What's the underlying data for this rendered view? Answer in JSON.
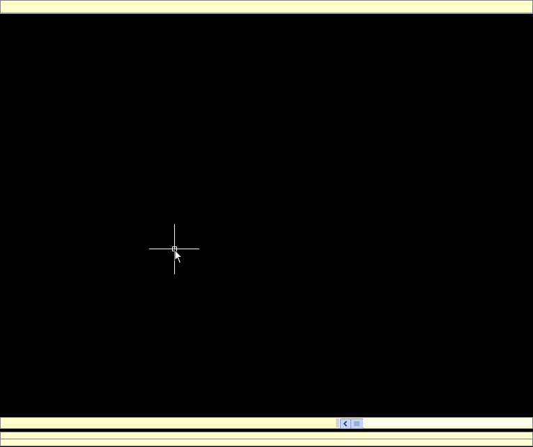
{
  "app": {
    "title_bar_text": "",
    "command_line_1": "",
    "command_line_2": ""
  },
  "colors": {
    "background": "#000000",
    "panel": "#ffffcc",
    "crosshair": "#ffffff",
    "scrollbar": "#c7d3f7"
  },
  "icons": {
    "crosshair": "crosshair-cursor-icon",
    "pointer": "arrow-cursor-icon",
    "scroll_left": "chevron-left-icon",
    "scroll_thumb": "scrollbar-thumb-grip-icon"
  }
}
